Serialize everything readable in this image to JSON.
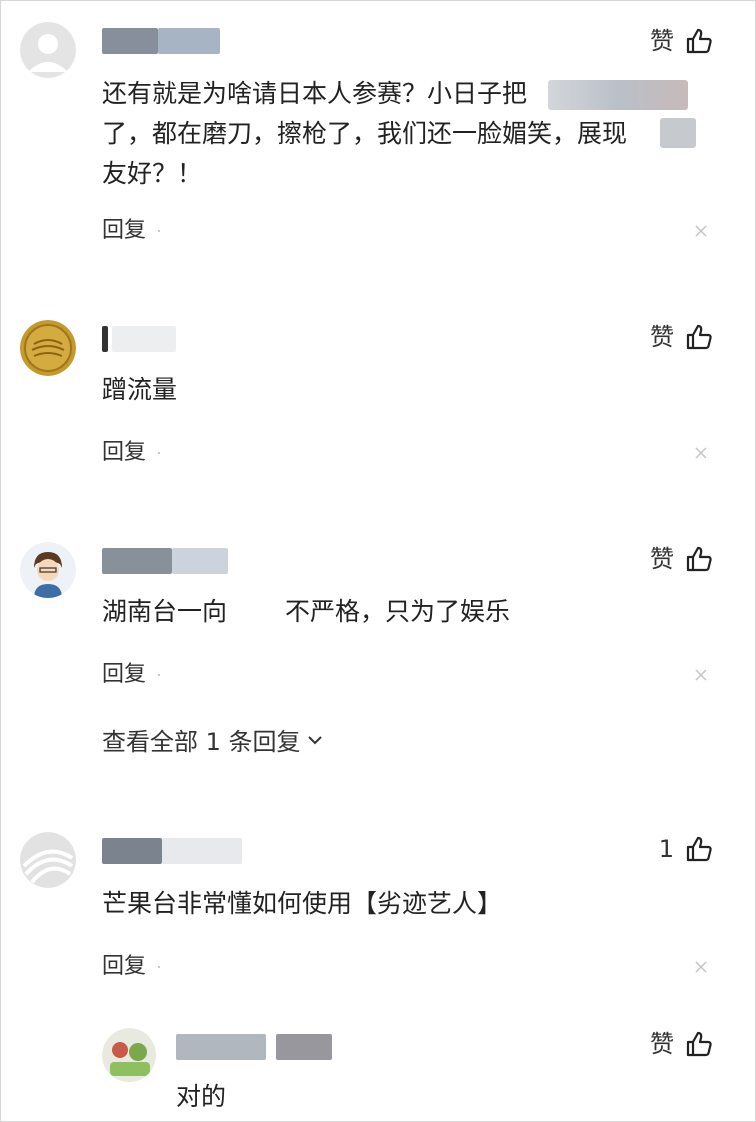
{
  "like_label": "赞",
  "reply_label": "回复",
  "comments": [
    {
      "text": "还有就是为啥请日本人参赛？小日子把",
      "text_line2": "了，都在磨刀，擦枪了，我们还一脸媚笑，展现",
      "text_line3": "友好？！"
    },
    {
      "text": "蹭流量"
    },
    {
      "text": "湖南台一向",
      "text_tail": "不严格，只为了娱乐",
      "view_all": "查看全部 1 条回复"
    },
    {
      "like_count": "1",
      "text": "芒果台非常懂如何使用【劣迹艺人】"
    }
  ],
  "sub_reply": {
    "text": "对的"
  }
}
